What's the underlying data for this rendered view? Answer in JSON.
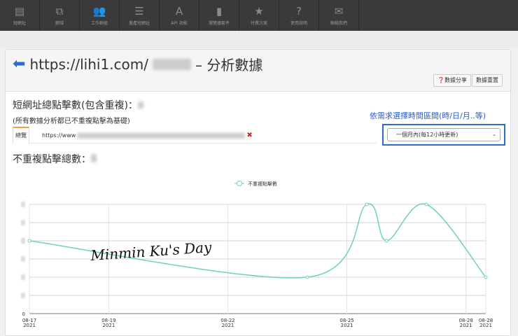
{
  "nav": [
    {
      "icon": "list-card-icon",
      "glyph": "▤",
      "label": "短網址"
    },
    {
      "icon": "external-link-icon",
      "glyph": "⧉",
      "label": "網域"
    },
    {
      "icon": "users-icon",
      "glyph": "👥",
      "label": "工作群組"
    },
    {
      "icon": "list-icon",
      "glyph": "☰",
      "label": "量產短網址"
    },
    {
      "icon": "font-icon",
      "glyph": "A",
      "label": "API 功能"
    },
    {
      "icon": "bookmark-icon",
      "glyph": "▮",
      "label": "瀏覽器套件"
    },
    {
      "icon": "star-icon",
      "glyph": "★",
      "label": "付費方案"
    },
    {
      "icon": "question-icon",
      "glyph": "?",
      "label": "使用說明"
    },
    {
      "icon": "envelope-icon",
      "glyph": "✉",
      "label": "聯絡我們"
    }
  ],
  "header": {
    "back_icon": "arrow-left-icon",
    "title_prefix": "https://lihi1.com/",
    "title_suffix": "– 分析數據",
    "share_label": "數據分享",
    "reset_label": "數據重置"
  },
  "stats": {
    "total_label": "短網址總點擊數(包含重複)：",
    "note": "(所有數據分析都已不重複點擊為基礎)",
    "unique_label": "不重複點擊總數："
  },
  "hint": "依需求選擇時間區間(時/日/月..等)",
  "tabs": {
    "overview": "總覽",
    "url_prefix": "https://www"
  },
  "range_select": {
    "value": "一個月內(每12小時更新)"
  },
  "watermark": "Minmin Ku's Day",
  "chart_data": {
    "type": "line",
    "legend": "不重複點擊數",
    "legend_position": "top-center",
    "color": "#6fd3b0",
    "x": [
      0,
      7,
      8.5,
      9,
      10,
      11.5
    ],
    "y": [
      4,
      2,
      6,
      4,
      6,
      2
    ],
    "xticks": [
      {
        "v": 0,
        "label": "08-17",
        "year": "2021"
      },
      {
        "v": 2,
        "label": "08-19",
        "year": "2021"
      },
      {
        "v": 5,
        "label": "08-22",
        "year": "2021"
      },
      {
        "v": 8,
        "label": "08-25",
        "year": "2021"
      },
      {
        "v": 11,
        "label": "08-28",
        "year": "2021"
      },
      {
        "v": 11.5,
        "label": "08-28",
        "year": "2021"
      }
    ],
    "ylim": [
      0,
      6
    ],
    "ytick_labels": [
      "0"
    ],
    "xlim": [
      0,
      11.5
    ],
    "grid": true
  }
}
